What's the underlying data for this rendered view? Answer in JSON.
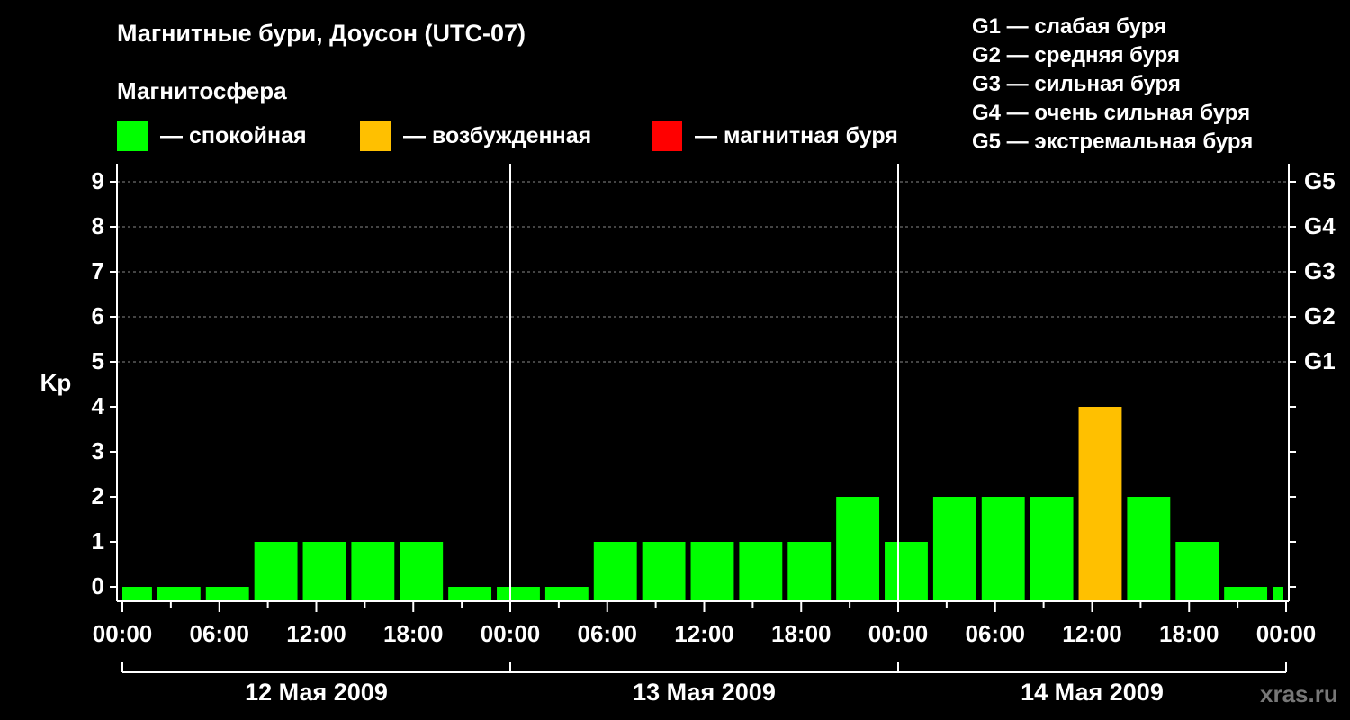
{
  "header": {
    "title": "Магнитные бури, Доусон (UTC-07)",
    "subtitle": "Магнитосфера"
  },
  "legend": {
    "items": [
      {
        "label": "— спокойная",
        "color": "#00ff00"
      },
      {
        "label": "— возбужденная",
        "color": "#ffc000"
      },
      {
        "label": "— магнитная буря",
        "color": "#ff0000"
      }
    ]
  },
  "storm_legend": [
    "G1 — слабая буря",
    "G2 — средняя буря",
    "G3 — сильная буря",
    "G4 — очень сильная буря",
    "G5 — экстремальная буря"
  ],
  "watermark": "xras.ru",
  "chart_data": {
    "type": "bar",
    "ylabel": "Kp",
    "ylim": [
      0,
      9
    ],
    "y_ticks": [
      "0",
      "1",
      "2",
      "3",
      "4",
      "5",
      "6",
      "7",
      "8",
      "9"
    ],
    "right_axis_labels": [
      {
        "kp": 5,
        "label": "G1"
      },
      {
        "kp": 6,
        "label": "G2"
      },
      {
        "kp": 7,
        "label": "G3"
      },
      {
        "kp": 8,
        "label": "G4"
      },
      {
        "kp": 9,
        "label": "G5"
      }
    ],
    "x_ticks": [
      "00:00",
      "06:00",
      "12:00",
      "18:00",
      "00:00",
      "06:00",
      "12:00",
      "18:00",
      "00:00",
      "06:00",
      "12:00",
      "18:00",
      "00:00"
    ],
    "days": [
      "12 Мая 2009",
      "13 Мая 2009",
      "14 Мая 2009"
    ],
    "grid": "dashed horizontal lines at Kp 5–9",
    "series": [
      {
        "bars": [
          {
            "start": "12 Мая 2009 00:00",
            "end": "12 Мая 2009 02:00",
            "kp": 0,
            "color": "#00ff00"
          },
          {
            "start": "12 Мая 2009 02:00",
            "end": "12 Мая 2009 05:00",
            "kp": 0,
            "color": "#00ff00"
          },
          {
            "start": "12 Мая 2009 05:00",
            "end": "12 Мая 2009 08:00",
            "kp": 0,
            "color": "#00ff00"
          },
          {
            "start": "12 Мая 2009 08:00",
            "end": "12 Мая 2009 11:00",
            "kp": 1,
            "color": "#00ff00"
          },
          {
            "start": "12 Мая 2009 11:00",
            "end": "12 Мая 2009 14:00",
            "kp": 1,
            "color": "#00ff00"
          },
          {
            "start": "12 Мая 2009 14:00",
            "end": "12 Мая 2009 17:00",
            "kp": 1,
            "color": "#00ff00"
          },
          {
            "start": "12 Мая 2009 17:00",
            "end": "12 Мая 2009 20:00",
            "kp": 1,
            "color": "#00ff00"
          },
          {
            "start": "12 Мая 2009 20:00",
            "end": "12 Мая 2009 23:00",
            "kp": 0,
            "color": "#00ff00"
          },
          {
            "start": "12 Мая 2009 23:00",
            "end": "13 Мая 2009 02:00",
            "kp": 0,
            "color": "#00ff00"
          },
          {
            "start": "13 Мая 2009 02:00",
            "end": "13 Мая 2009 05:00",
            "kp": 0,
            "color": "#00ff00"
          },
          {
            "start": "13 Мая 2009 05:00",
            "end": "13 Мая 2009 08:00",
            "kp": 1,
            "color": "#00ff00"
          },
          {
            "start": "13 Мая 2009 08:00",
            "end": "13 Мая 2009 11:00",
            "kp": 1,
            "color": "#00ff00"
          },
          {
            "start": "13 Мая 2009 11:00",
            "end": "13 Мая 2009 14:00",
            "kp": 1,
            "color": "#00ff00"
          },
          {
            "start": "13 Мая 2009 14:00",
            "end": "13 Мая 2009 17:00",
            "kp": 1,
            "color": "#00ff00"
          },
          {
            "start": "13 Мая 2009 17:00",
            "end": "13 Мая 2009 20:00",
            "kp": 1,
            "color": "#00ff00"
          },
          {
            "start": "13 Мая 2009 20:00",
            "end": "13 Мая 2009 23:00",
            "kp": 2,
            "color": "#00ff00"
          },
          {
            "start": "13 Мая 2009 23:00",
            "end": "14 Мая 2009 02:00",
            "kp": 1,
            "color": "#00ff00"
          },
          {
            "start": "14 Мая 2009 02:00",
            "end": "14 Мая 2009 05:00",
            "kp": 2,
            "color": "#00ff00"
          },
          {
            "start": "14 Мая 2009 05:00",
            "end": "14 Мая 2009 08:00",
            "kp": 2,
            "color": "#00ff00"
          },
          {
            "start": "14 Мая 2009 08:00",
            "end": "14 Мая 2009 11:00",
            "kp": 2,
            "color": "#00ff00"
          },
          {
            "start": "14 Мая 2009 11:00",
            "end": "14 Мая 2009 14:00",
            "kp": 4,
            "color": "#ffc000"
          },
          {
            "start": "14 Мая 2009 14:00",
            "end": "14 Мая 2009 17:00",
            "kp": 2,
            "color": "#00ff00"
          },
          {
            "start": "14 Мая 2009 17:00",
            "end": "14 Мая 2009 20:00",
            "kp": 1,
            "color": "#00ff00"
          },
          {
            "start": "14 Мая 2009 20:00",
            "end": "14 Мая 2009 23:00",
            "kp": 0,
            "color": "#00ff00"
          },
          {
            "start": "14 Мая 2009 23:00",
            "end": "15 Мая 2009 00:00",
            "kp": 0,
            "color": "#00ff00"
          }
        ]
      }
    ]
  }
}
